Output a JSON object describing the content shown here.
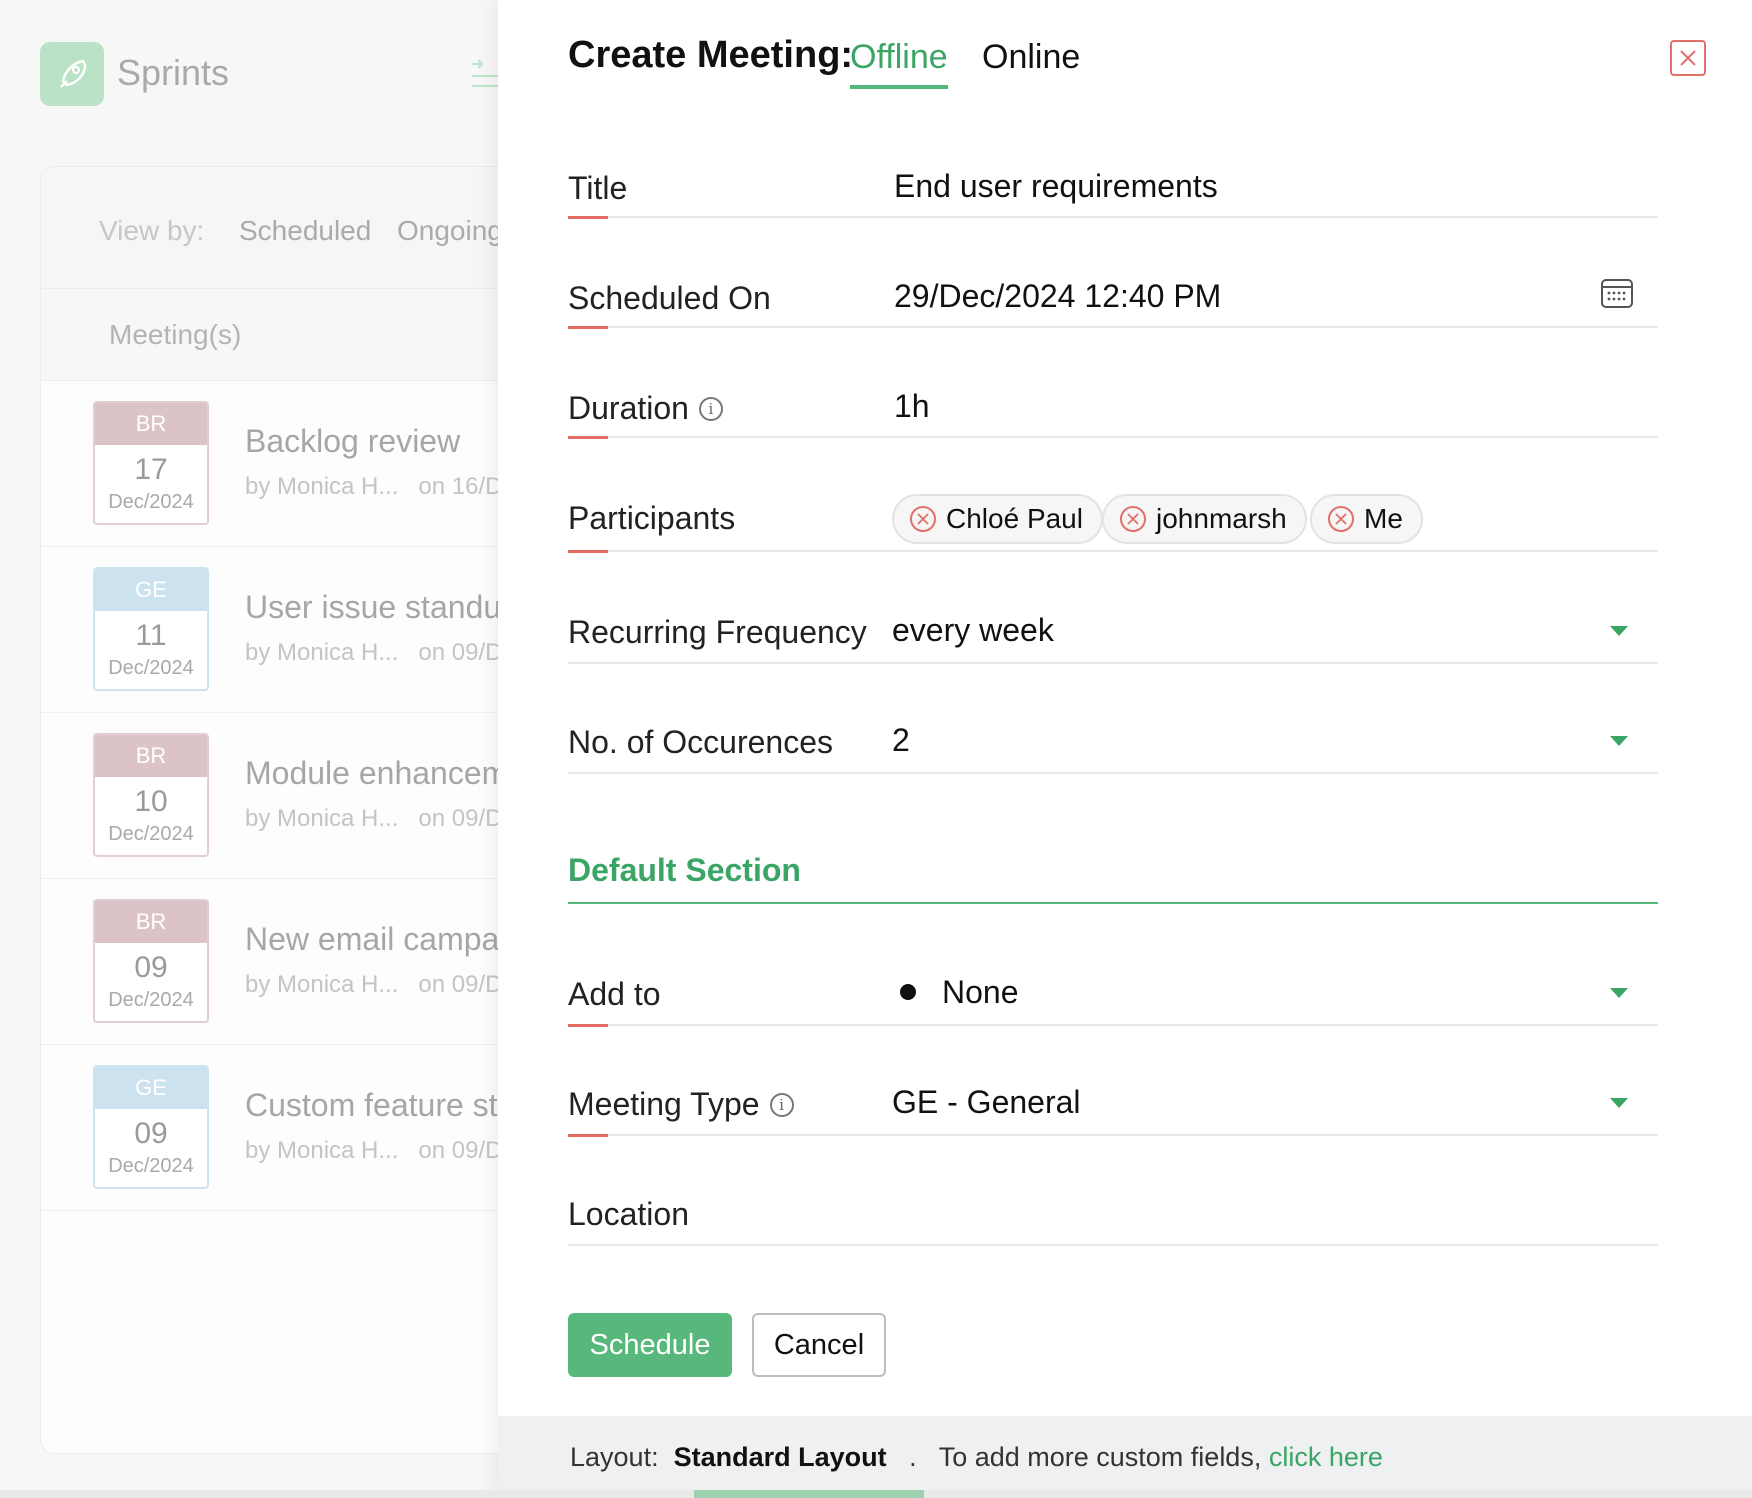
{
  "background": {
    "app_title": "Sprints",
    "view_by": {
      "label": "View by:",
      "options": [
        "Scheduled",
        "Ongoing"
      ]
    },
    "list_header": "Meeting(s)",
    "meetings": [
      {
        "tag": "BR",
        "day": "17",
        "month_year": "Dec/2024",
        "title": "Backlog review",
        "by": "by Monica H...",
        "on": "on 16/D"
      },
      {
        "tag": "GE",
        "day": "11",
        "month_year": "Dec/2024",
        "title": "User issue standu",
        "by": "by Monica H...",
        "on": "on 09/D"
      },
      {
        "tag": "BR",
        "day": "10",
        "month_year": "Dec/2024",
        "title": "Module enhancem",
        "by": "by Monica H...",
        "on": "on 09/D"
      },
      {
        "tag": "BR",
        "day": "09",
        "month_year": "Dec/2024",
        "title": "New email campai",
        "by": "by Monica H...",
        "on": "on 09/D"
      },
      {
        "tag": "GE",
        "day": "09",
        "month_year": "Dec/2024",
        "title": "Custom feature st",
        "by": "by Monica H...",
        "on": "on 09/D"
      }
    ]
  },
  "drawer": {
    "title": "Create Meeting:",
    "tabs": {
      "offline": "Offline",
      "online": "Online",
      "active": "offline"
    },
    "fields": {
      "title": {
        "label": "Title",
        "value": "End user requirements"
      },
      "scheduled_on": {
        "label": "Scheduled On",
        "value": "29/Dec/2024 12:40 PM"
      },
      "duration": {
        "label": "Duration",
        "value": "1h"
      },
      "participants": {
        "label": "Participants",
        "chips": [
          "Chloé Paul",
          "johnmarsh",
          "Me"
        ]
      },
      "recurring_frequency": {
        "label": "Recurring Frequency",
        "value": "every week"
      },
      "occurrences": {
        "label": "No. of Occurences",
        "value": "2"
      },
      "add_to": {
        "label": "Add to",
        "value": "None"
      },
      "meeting_type": {
        "label": "Meeting Type",
        "value": "GE - General"
      },
      "location": {
        "label": "Location",
        "value": ""
      }
    },
    "section_title": "Default Section",
    "buttons": {
      "schedule": "Schedule",
      "cancel": "Cancel"
    },
    "footer": {
      "layout_label": "Layout:",
      "layout_value": "Standard Layout",
      "separator": ".",
      "custom_text": "To add more custom fields,",
      "link_text": "click here"
    }
  },
  "colors": {
    "accent_green": "#3aa565",
    "schedule_button": "#58b77b",
    "label_accent_red": "#e46a62",
    "tag_br": "#dcc3c8",
    "tag_ge": "#cce2ee"
  }
}
